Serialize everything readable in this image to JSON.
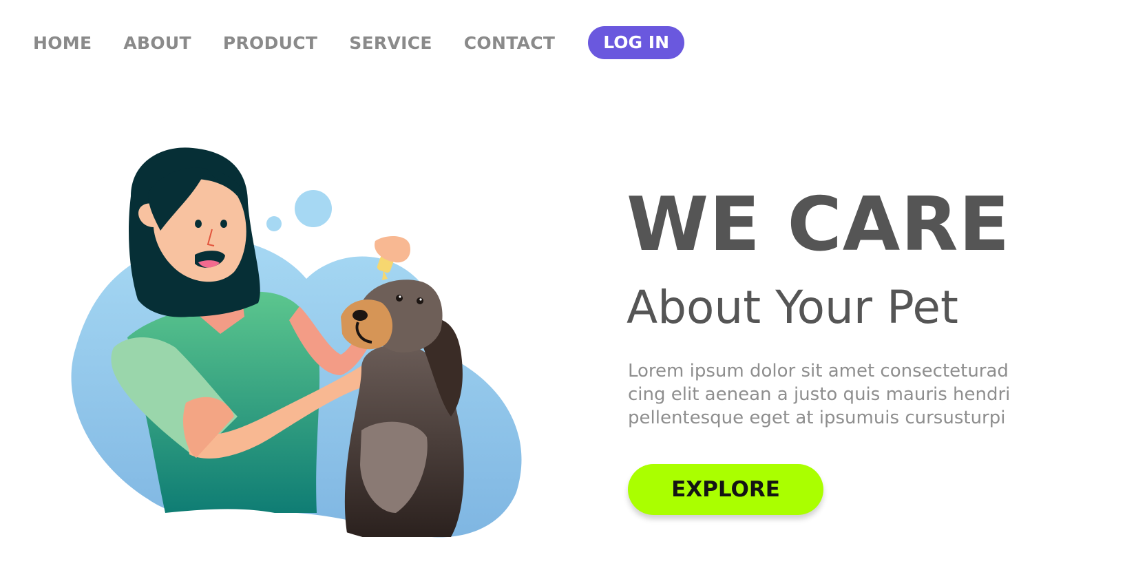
{
  "nav": {
    "items": [
      "HOME",
      "ABOUT",
      "PRODUCT",
      "SERVICE",
      "CONTACT"
    ],
    "login_label": "LOG IN"
  },
  "hero": {
    "title": "WE CARE",
    "subtitle": "About Your Pet",
    "body_lines": [
      "Lorem ipsum dolor sit amet consecteturad",
      "cing elit aenean a justo quis mauris hendri",
      "pellentesque eget at ipsumuis cursusturpi"
    ],
    "cta_label": "EXPLORE"
  },
  "colors": {
    "login_bg": "#6a58de",
    "cta_bg": "#aaff00",
    "heading": "#555555",
    "nav_text": "#8a8a8a",
    "blob": "#9fd2ef"
  }
}
